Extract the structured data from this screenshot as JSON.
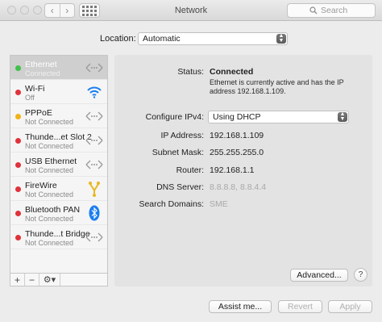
{
  "window": {
    "title": "Network"
  },
  "search": {
    "placeholder": "Search"
  },
  "location": {
    "label": "Location:",
    "value": "Automatic"
  },
  "services": [
    {
      "name": "Ethernet",
      "status": "Connected",
      "dot": "#3fc14a",
      "icon": "ethernet-arrows-icon",
      "selected": true
    },
    {
      "name": "Wi-Fi",
      "status": "Off",
      "dot": "#e0323a",
      "icon": "wifi-icon"
    },
    {
      "name": "PPPoE",
      "status": "Not Connected",
      "dot": "#f2b318",
      "icon": "ethernet-arrows-icon"
    },
    {
      "name": "Thunde...et Slot 2",
      "status": "Not Connected",
      "dot": "#e0323a",
      "icon": "ethernet-arrows-icon"
    },
    {
      "name": "USB Ethernet",
      "status": "Not Connected",
      "dot": "#e0323a",
      "icon": "ethernet-arrows-icon"
    },
    {
      "name": "FireWire",
      "status": "Not Connected",
      "dot": "#e0323a",
      "icon": "firewire-icon"
    },
    {
      "name": "Bluetooth PAN",
      "status": "Not Connected",
      "dot": "#e0323a",
      "icon": "bluetooth-icon"
    },
    {
      "name": "Thunde...t Bridge",
      "status": "Not Connected",
      "dot": "#e0323a",
      "icon": "ethernet-arrows-icon"
    }
  ],
  "toolbar": {
    "add": "+",
    "remove": "−",
    "gear": "⚙▾"
  },
  "detail": {
    "status_label": "Status:",
    "status_value": "Connected",
    "status_desc": "Ethernet is currently active and has the IP address 192.168.1.109.",
    "configure_label": "Configure IPv4:",
    "configure_value": "Using DHCP",
    "ip_label": "IP Address:",
    "ip_value": "192.168.1.109",
    "subnet_label": "Subnet Mask:",
    "subnet_value": "255.255.255.0",
    "router_label": "Router:",
    "router_value": "192.168.1.1",
    "dns_label": "DNS Server:",
    "dns_value": "8.8.8.8, 8.8.4.4",
    "domains_label": "Search Domains:",
    "domains_value": "SME",
    "advanced": "Advanced...",
    "help": "?"
  },
  "footer": {
    "assist": "Assist me...",
    "revert": "Revert",
    "apply": "Apply"
  },
  "colors": {
    "accent_blue": "#1a7df0",
    "firewire_yellow": "#e8b820",
    "selected_row": "#cfcfcf"
  }
}
